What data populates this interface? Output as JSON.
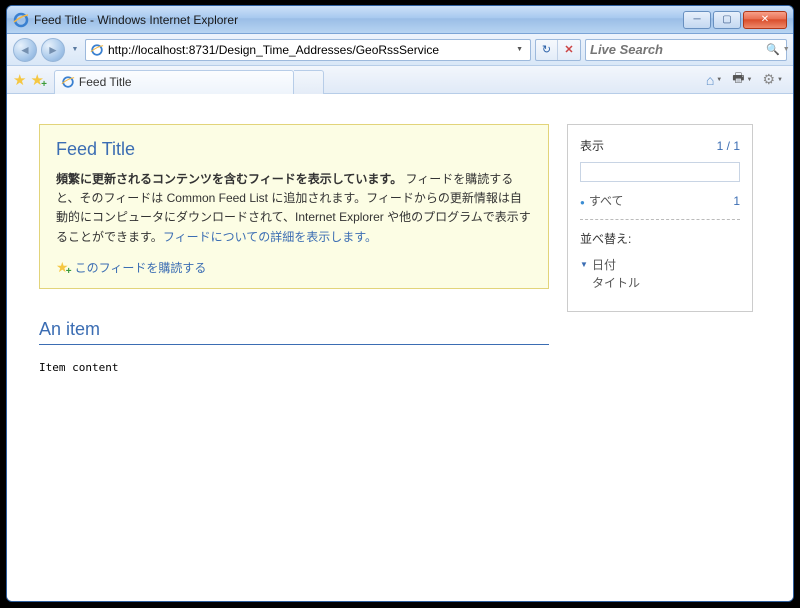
{
  "window": {
    "title": "Feed Title - Windows Internet Explorer"
  },
  "address": {
    "url": "http://localhost:8731/Design_Time_Addresses/GeoRssService"
  },
  "search": {
    "placeholder": "Live Search"
  },
  "tab": {
    "label": "Feed Title"
  },
  "feed": {
    "title": "Feed Title",
    "bold_text": "頻繁に更新されるコンテンツを含むフィードを表示しています。",
    "body_text": " フィードを購読すると、そのフィードは Common Feed List に追加されます。フィードからの更新情報は自動的にコンピュータにダウンロードされて、Internet Explorer や他のプログラムで表示することができます。",
    "about_link": "フィードについての詳細を表示します。",
    "subscribe_link": "このフィードを購読する"
  },
  "item": {
    "title": "An item",
    "content": "Item content"
  },
  "sidebar": {
    "display_label": "表示",
    "display_count": "1 / 1",
    "filter_all": "すべて",
    "filter_all_count": "1",
    "sort_label": "並べ替え:",
    "sort_date": "日付",
    "sort_title": "タイトル"
  }
}
